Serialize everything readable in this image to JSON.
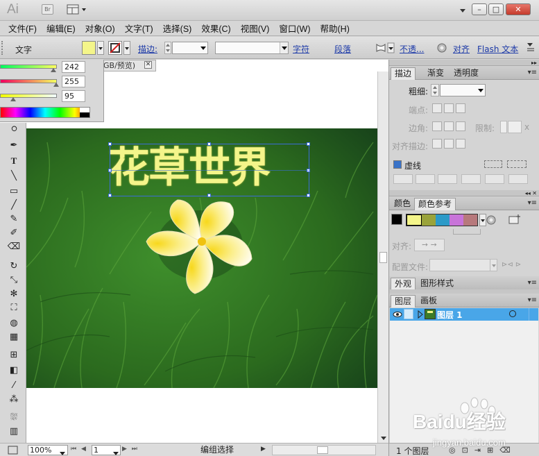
{
  "app": {
    "logo": "Ai",
    "bridge_label": "Br"
  },
  "window_controls": {
    "minimize": "–",
    "restore": "□",
    "close": "✕"
  },
  "menu": [
    "文件(F)",
    "编辑(E)",
    "对象(O)",
    "文字(T)",
    "选择(S)",
    "效果(C)",
    "视图(V)",
    "窗口(W)",
    "帮助(H)"
  ],
  "control_bar": {
    "context_label": "文字",
    "fill_color": "#f4f58a",
    "stroke_label": "描边:",
    "char_label": "字符",
    "para_label": "段落",
    "opacity_label": "不透...",
    "align_label": "对齐",
    "flash_label": "Flash 文本"
  },
  "document": {
    "tab_title": "GB/预览)",
    "close": "✕"
  },
  "color_panel": {
    "values": [
      "242",
      "255",
      "95"
    ]
  },
  "artwork": {
    "headline": "花草世界",
    "headline_color": "#f4f58a"
  },
  "stroke_panel": {
    "tabs": [
      "描边",
      "渐变",
      "透明度"
    ],
    "weight_label": "粗细:",
    "cap_label": "端点:",
    "corner_label": "边角:",
    "limit_label": "限制:",
    "limit_unit": "x",
    "align_label": "对齐描边:",
    "dashed_label": "虚线"
  },
  "color_guide_panel": {
    "tabs": [
      "颜色",
      "颜色参考"
    ],
    "swatches": [
      "#f4f58a",
      "#9aa33a",
      "#2c9ac8",
      "#c874d9",
      "#b7797c"
    ],
    "align_label": "对齐:",
    "config_label": "配置文件:"
  },
  "appearance_panel": {
    "tabs": [
      "外观",
      "图形样式"
    ]
  },
  "layers_panel": {
    "tabs": [
      "图层",
      "画板"
    ],
    "layer_name": "图层 1",
    "count_label": "1 个图层"
  },
  "status_bar": {
    "zoom": "100%",
    "page": "1",
    "status": "编组选择"
  },
  "watermark": {
    "brand": "Baidu经验",
    "url": "jingyan.baidu.com"
  }
}
